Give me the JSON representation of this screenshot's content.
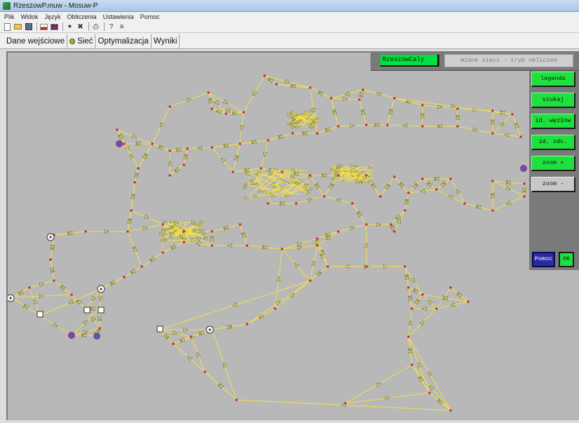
{
  "window": {
    "title": "RzeszowP.muw - Mosuw-P"
  },
  "menu": [
    "Plik",
    "Widok",
    "Język",
    "Obliczenia",
    "Ustawienia",
    "Pomoc"
  ],
  "tabs": [
    {
      "label": "Dane wejściowe",
      "active": false
    },
    {
      "label": "Sieć",
      "active": true
    },
    {
      "label": "Optymalizacja",
      "active": false
    },
    {
      "label": "Wyniki",
      "active": false
    }
  ],
  "status": {
    "network_name": "RzeszowCaly",
    "view_mode": "Widok sieci - tryb obliczeń"
  },
  "side_buttons": {
    "legend": "legenda",
    "search": "szukaj",
    "node_ids": "id. węzłów",
    "segment_ids": "id. odc.",
    "zoom_in": "zoom +",
    "zoom_out": "zoom -"
  },
  "bottom_buttons": {
    "help": "Pomoc",
    "ok": "OK"
  },
  "colors": {
    "canvas": "#b8b8b8",
    "link": "#f2e04a",
    "node": "#c01a4a",
    "arrow": "#6a6a2a",
    "button_green": "#20e040",
    "panel": "#7a7a7a",
    "help_blue": "#2a2aa0"
  },
  "icons": [
    "new-file-icon",
    "open-folder-icon",
    "save-icon",
    "flag-pl-icon",
    "flag-uk-icon",
    "run-icon",
    "settings-icon",
    "print-icon",
    "help-icon",
    "about-icon"
  ]
}
